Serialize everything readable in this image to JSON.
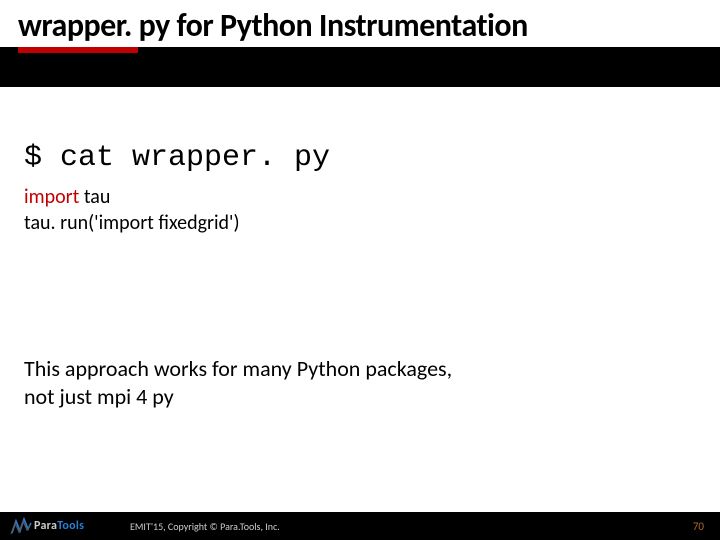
{
  "title": "wrapper. py for Python Instrumentation",
  "command": "$ cat wrapper. py",
  "code": {
    "import_kw": "import",
    "import_mod": " tau",
    "line2": "tau. run('import fixedgrid')"
  },
  "summary_line1": "This approach works for many Python packages,",
  "summary_line2": "not just mpi 4 py",
  "footer": {
    "logo_para": "Para",
    "logo_tools": "Tools",
    "copyright": "EMIT'15, Copyright © Para.Tools, Inc.",
    "page": "70"
  }
}
